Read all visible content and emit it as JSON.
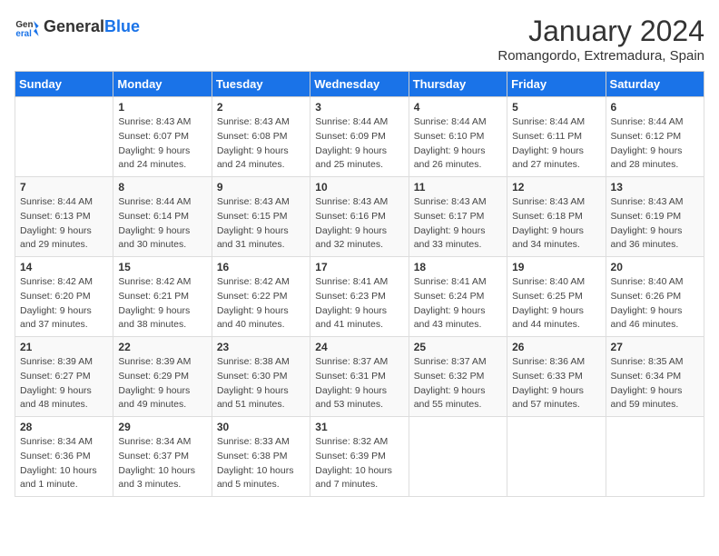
{
  "header": {
    "logo_general": "General",
    "logo_blue": "Blue",
    "month_title": "January 2024",
    "location": "Romangordo, Extremadura, Spain"
  },
  "weekdays": [
    "Sunday",
    "Monday",
    "Tuesday",
    "Wednesday",
    "Thursday",
    "Friday",
    "Saturday"
  ],
  "weeks": [
    [
      {
        "day": "",
        "sunrise": "",
        "sunset": "",
        "daylight": ""
      },
      {
        "day": "1",
        "sunrise": "Sunrise: 8:43 AM",
        "sunset": "Sunset: 6:07 PM",
        "daylight": "Daylight: 9 hours and 24 minutes."
      },
      {
        "day": "2",
        "sunrise": "Sunrise: 8:43 AM",
        "sunset": "Sunset: 6:08 PM",
        "daylight": "Daylight: 9 hours and 24 minutes."
      },
      {
        "day": "3",
        "sunrise": "Sunrise: 8:44 AM",
        "sunset": "Sunset: 6:09 PM",
        "daylight": "Daylight: 9 hours and 25 minutes."
      },
      {
        "day": "4",
        "sunrise": "Sunrise: 8:44 AM",
        "sunset": "Sunset: 6:10 PM",
        "daylight": "Daylight: 9 hours and 26 minutes."
      },
      {
        "day": "5",
        "sunrise": "Sunrise: 8:44 AM",
        "sunset": "Sunset: 6:11 PM",
        "daylight": "Daylight: 9 hours and 27 minutes."
      },
      {
        "day": "6",
        "sunrise": "Sunrise: 8:44 AM",
        "sunset": "Sunset: 6:12 PM",
        "daylight": "Daylight: 9 hours and 28 minutes."
      }
    ],
    [
      {
        "day": "7",
        "sunrise": "Sunrise: 8:44 AM",
        "sunset": "Sunset: 6:13 PM",
        "daylight": "Daylight: 9 hours and 29 minutes."
      },
      {
        "day": "8",
        "sunrise": "Sunrise: 8:44 AM",
        "sunset": "Sunset: 6:14 PM",
        "daylight": "Daylight: 9 hours and 30 minutes."
      },
      {
        "day": "9",
        "sunrise": "Sunrise: 8:43 AM",
        "sunset": "Sunset: 6:15 PM",
        "daylight": "Daylight: 9 hours and 31 minutes."
      },
      {
        "day": "10",
        "sunrise": "Sunrise: 8:43 AM",
        "sunset": "Sunset: 6:16 PM",
        "daylight": "Daylight: 9 hours and 32 minutes."
      },
      {
        "day": "11",
        "sunrise": "Sunrise: 8:43 AM",
        "sunset": "Sunset: 6:17 PM",
        "daylight": "Daylight: 9 hours and 33 minutes."
      },
      {
        "day": "12",
        "sunrise": "Sunrise: 8:43 AM",
        "sunset": "Sunset: 6:18 PM",
        "daylight": "Daylight: 9 hours and 34 minutes."
      },
      {
        "day": "13",
        "sunrise": "Sunrise: 8:43 AM",
        "sunset": "Sunset: 6:19 PM",
        "daylight": "Daylight: 9 hours and 36 minutes."
      }
    ],
    [
      {
        "day": "14",
        "sunrise": "Sunrise: 8:42 AM",
        "sunset": "Sunset: 6:20 PM",
        "daylight": "Daylight: 9 hours and 37 minutes."
      },
      {
        "day": "15",
        "sunrise": "Sunrise: 8:42 AM",
        "sunset": "Sunset: 6:21 PM",
        "daylight": "Daylight: 9 hours and 38 minutes."
      },
      {
        "day": "16",
        "sunrise": "Sunrise: 8:42 AM",
        "sunset": "Sunset: 6:22 PM",
        "daylight": "Daylight: 9 hours and 40 minutes."
      },
      {
        "day": "17",
        "sunrise": "Sunrise: 8:41 AM",
        "sunset": "Sunset: 6:23 PM",
        "daylight": "Daylight: 9 hours and 41 minutes."
      },
      {
        "day": "18",
        "sunrise": "Sunrise: 8:41 AM",
        "sunset": "Sunset: 6:24 PM",
        "daylight": "Daylight: 9 hours and 43 minutes."
      },
      {
        "day": "19",
        "sunrise": "Sunrise: 8:40 AM",
        "sunset": "Sunset: 6:25 PM",
        "daylight": "Daylight: 9 hours and 44 minutes."
      },
      {
        "day": "20",
        "sunrise": "Sunrise: 8:40 AM",
        "sunset": "Sunset: 6:26 PM",
        "daylight": "Daylight: 9 hours and 46 minutes."
      }
    ],
    [
      {
        "day": "21",
        "sunrise": "Sunrise: 8:39 AM",
        "sunset": "Sunset: 6:27 PM",
        "daylight": "Daylight: 9 hours and 48 minutes."
      },
      {
        "day": "22",
        "sunrise": "Sunrise: 8:39 AM",
        "sunset": "Sunset: 6:29 PM",
        "daylight": "Daylight: 9 hours and 49 minutes."
      },
      {
        "day": "23",
        "sunrise": "Sunrise: 8:38 AM",
        "sunset": "Sunset: 6:30 PM",
        "daylight": "Daylight: 9 hours and 51 minutes."
      },
      {
        "day": "24",
        "sunrise": "Sunrise: 8:37 AM",
        "sunset": "Sunset: 6:31 PM",
        "daylight": "Daylight: 9 hours and 53 minutes."
      },
      {
        "day": "25",
        "sunrise": "Sunrise: 8:37 AM",
        "sunset": "Sunset: 6:32 PM",
        "daylight": "Daylight: 9 hours and 55 minutes."
      },
      {
        "day": "26",
        "sunrise": "Sunrise: 8:36 AM",
        "sunset": "Sunset: 6:33 PM",
        "daylight": "Daylight: 9 hours and 57 minutes."
      },
      {
        "day": "27",
        "sunrise": "Sunrise: 8:35 AM",
        "sunset": "Sunset: 6:34 PM",
        "daylight": "Daylight: 9 hours and 59 minutes."
      }
    ],
    [
      {
        "day": "28",
        "sunrise": "Sunrise: 8:34 AM",
        "sunset": "Sunset: 6:36 PM",
        "daylight": "Daylight: 10 hours and 1 minute."
      },
      {
        "day": "29",
        "sunrise": "Sunrise: 8:34 AM",
        "sunset": "Sunset: 6:37 PM",
        "daylight": "Daylight: 10 hours and 3 minutes."
      },
      {
        "day": "30",
        "sunrise": "Sunrise: 8:33 AM",
        "sunset": "Sunset: 6:38 PM",
        "daylight": "Daylight: 10 hours and 5 minutes."
      },
      {
        "day": "31",
        "sunrise": "Sunrise: 8:32 AM",
        "sunset": "Sunset: 6:39 PM",
        "daylight": "Daylight: 10 hours and 7 minutes."
      },
      {
        "day": "",
        "sunrise": "",
        "sunset": "",
        "daylight": ""
      },
      {
        "day": "",
        "sunrise": "",
        "sunset": "",
        "daylight": ""
      },
      {
        "day": "",
        "sunrise": "",
        "sunset": "",
        "daylight": ""
      }
    ]
  ]
}
